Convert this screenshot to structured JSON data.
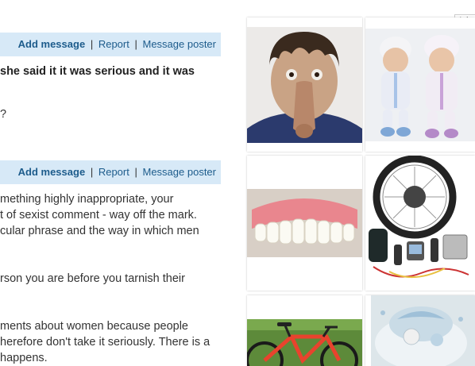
{
  "thread_actions": {
    "add_message": "Add message",
    "separator": "|",
    "report": "Report",
    "message_poster": "Message poster"
  },
  "posts": [
    {
      "lines": [
        "she said it it was serious and it was",
        "?"
      ]
    },
    {
      "lines": [
        "mething highly inappropriate, your",
        "t of sexist comment - way off the mark.",
        "cular phrase and the way in which men",
        "rson you are before you tarnish their",
        "ments about women because people",
        "herefore don't take it seriously. There is a",
        "happens."
      ]
    }
  ],
  "ad": {
    "label": "Ad",
    "tiles": [
      {
        "icon": "mask-image"
      },
      {
        "icon": "dolls-image"
      },
      {
        "icon": "dentures-image"
      },
      {
        "icon": "ebike-kit-image"
      },
      {
        "icon": "bicycle-image"
      },
      {
        "icon": "diaper-cake-image"
      }
    ]
  }
}
